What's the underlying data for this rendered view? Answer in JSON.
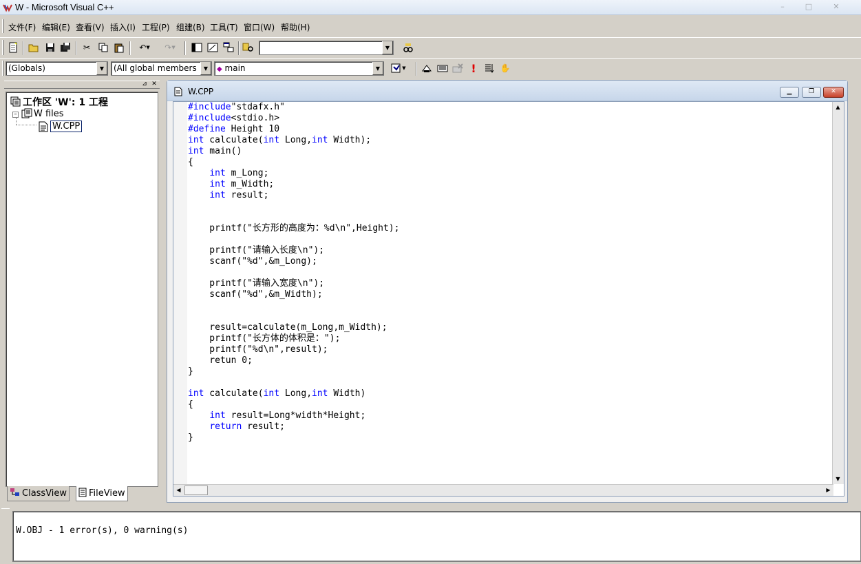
{
  "window": {
    "title": "W - Microsoft Visual C++",
    "controls": [
      "min",
      "max",
      "close"
    ]
  },
  "menubar": {
    "items": [
      "文件(F)",
      "编辑(E)",
      "查看(V)",
      "插入(I)",
      "工程(P)",
      "组建(B)",
      "工具(T)",
      "窗口(W)",
      "帮助(H)"
    ]
  },
  "toolbar2": {
    "scope_combo": "(Globals)",
    "members_combo": "(All global members",
    "function_combo": "main",
    "find_combo": ""
  },
  "workspace": {
    "root": "工作区 'W': 1 工程",
    "project": "W files",
    "file": "W.CPP",
    "tabs": [
      "ClassView",
      "FileView"
    ]
  },
  "editor": {
    "doc_title": "W.CPP",
    "code_lines": [
      [
        [
          "kw",
          "#include"
        ],
        [
          "t",
          "\"stdafx.h\""
        ]
      ],
      [
        [
          "kw",
          "#include"
        ],
        [
          "t",
          "<stdio.h>"
        ]
      ],
      [
        [
          "kw",
          "#define"
        ],
        [
          "t",
          " Height 10"
        ]
      ],
      [
        [
          "kw",
          "int"
        ],
        [
          "t",
          " calculate("
        ],
        [
          "kw",
          "int"
        ],
        [
          "t",
          " Long,"
        ],
        [
          "kw",
          "int"
        ],
        [
          "t",
          " Width);"
        ]
      ],
      [
        [
          "kw",
          "int"
        ],
        [
          "t",
          " main()"
        ]
      ],
      [
        [
          "t",
          "{"
        ]
      ],
      [
        [
          "t",
          "    "
        ],
        [
          "kw",
          "int"
        ],
        [
          "t",
          " m_Long;"
        ]
      ],
      [
        [
          "t",
          "    "
        ],
        [
          "kw",
          "int"
        ],
        [
          "t",
          " m_Width;"
        ]
      ],
      [
        [
          "t",
          "    "
        ],
        [
          "kw",
          "int"
        ],
        [
          "t",
          " result;"
        ]
      ],
      [
        [
          "t",
          ""
        ]
      ],
      [
        [
          "t",
          ""
        ]
      ],
      [
        [
          "t",
          "    printf(\"长方形的高度为：%d\\n\",Height);"
        ]
      ],
      [
        [
          "t",
          ""
        ]
      ],
      [
        [
          "t",
          "    printf(\"请输入长度\\n\");"
        ]
      ],
      [
        [
          "t",
          "    scanf(\"%d\",&m_Long);"
        ]
      ],
      [
        [
          "t",
          ""
        ]
      ],
      [
        [
          "t",
          "    printf(\"请输入宽度\\n\");"
        ]
      ],
      [
        [
          "t",
          "    scanf(\"%d\",&m_Width);"
        ]
      ],
      [
        [
          "t",
          ""
        ]
      ],
      [
        [
          "t",
          ""
        ]
      ],
      [
        [
          "t",
          "    result=calculate(m_Long,m_Width);"
        ]
      ],
      [
        [
          "t",
          "    printf(\"长方体的体积是：\");"
        ]
      ],
      [
        [
          "t",
          "    printf(\"%d\\n\",result);"
        ]
      ],
      [
        [
          "t",
          "    retun 0;"
        ]
      ],
      [
        [
          "t",
          "}"
        ]
      ],
      [
        [
          "t",
          ""
        ]
      ],
      [
        [
          "kw",
          "int"
        ],
        [
          "t",
          " calculate("
        ],
        [
          "kw",
          "int"
        ],
        [
          "t",
          " Long,"
        ],
        [
          "kw",
          "int"
        ],
        [
          "t",
          " Width)"
        ]
      ],
      [
        [
          "t",
          "{"
        ]
      ],
      [
        [
          "t",
          "    "
        ],
        [
          "kw",
          "int"
        ],
        [
          "t",
          " result=Long*width*Height;"
        ]
      ],
      [
        [
          "t",
          "    "
        ],
        [
          "kw",
          "return"
        ],
        [
          "t",
          " result;"
        ]
      ],
      [
        [
          "t",
          "}"
        ]
      ]
    ]
  },
  "output": {
    "text": "W.OBJ - 1 error(s), 0 warning(s)"
  },
  "colors": {
    "keyword": "#0000ff",
    "chrome": "#d4d0c8"
  }
}
